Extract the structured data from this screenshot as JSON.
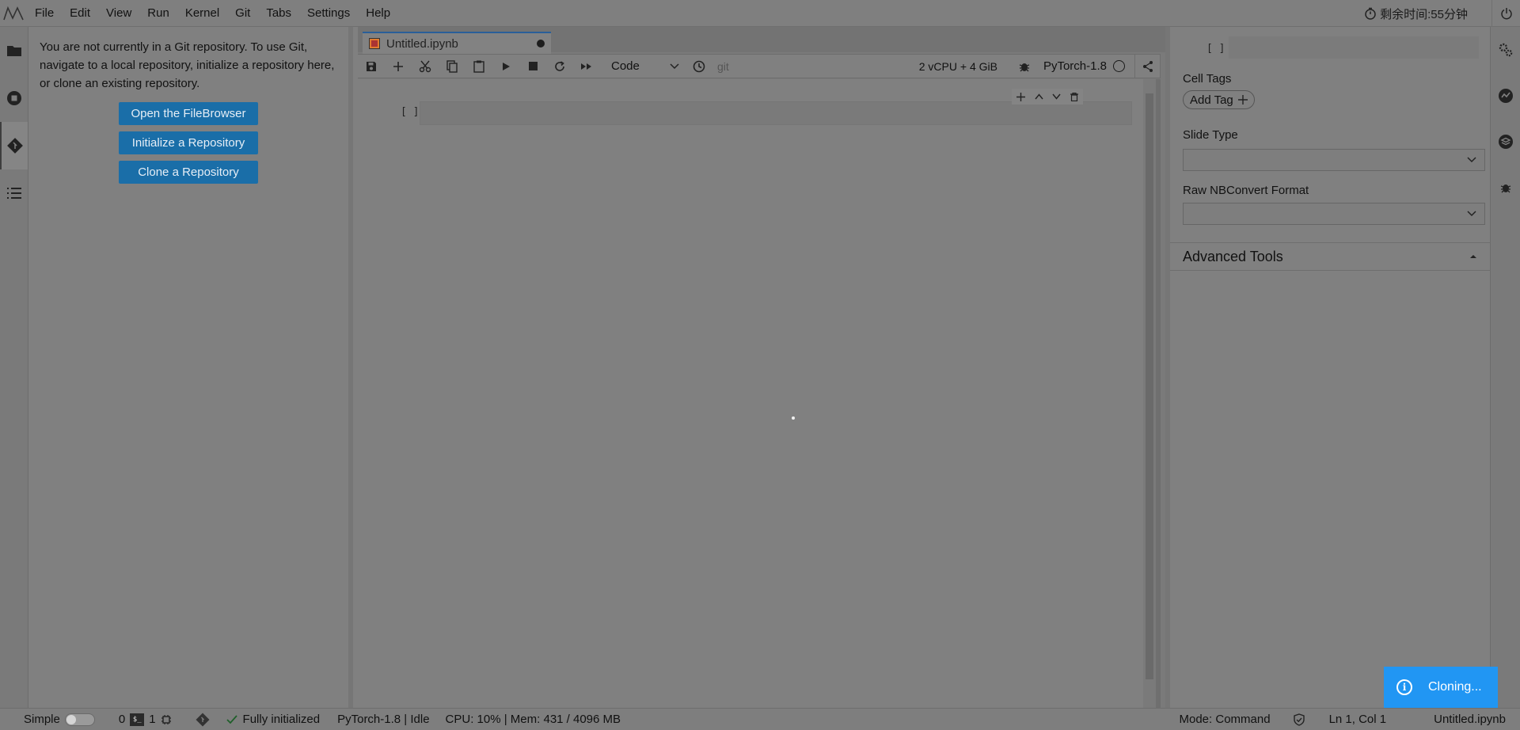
{
  "menubar": {
    "items": [
      "File",
      "Edit",
      "View",
      "Run",
      "Kernel",
      "Git",
      "Tabs",
      "Settings",
      "Help"
    ],
    "timer": "剩余时间:55分钟"
  },
  "git_panel": {
    "message": "You are not currently in a Git repository. To use Git, navigate to a local repository, initialize a repository here, or clone an existing repository.",
    "buttons": [
      "Open the FileBrowser",
      "Initialize a Repository",
      "Clone a Repository"
    ]
  },
  "notebook": {
    "tab_title": "Untitled.ipynb",
    "cell_type": "Code",
    "git_label": "git",
    "resources": "2 vCPU + 4 GiB",
    "kernel": "PyTorch-1.8",
    "cell_prompt": "[ ]"
  },
  "property_inspector": {
    "prompt": "[ ]",
    "cell_tags_label": "Cell Tags",
    "add_tag_label": "Add Tag",
    "slide_type_label": "Slide Type",
    "raw_format_label": "Raw NBConvert Format",
    "advanced_tools_label": "Advanced Tools"
  },
  "statusbar": {
    "simple_label": "Simple",
    "terminals_count": "0",
    "kernels_count": "1",
    "git_status": "Fully initialized",
    "kernel_status": "PyTorch-1.8 | Idle",
    "usage": "CPU: 10% | Mem: 431 / 4096 MB",
    "mode": "Mode: Command",
    "cursor": "Ln 1, Col 1",
    "filename": "Untitled.ipynb"
  },
  "toast": {
    "message": "Cloning..."
  },
  "colors": {
    "toast_bg": "#2196f3",
    "button_bg": "#1a6ea8"
  }
}
